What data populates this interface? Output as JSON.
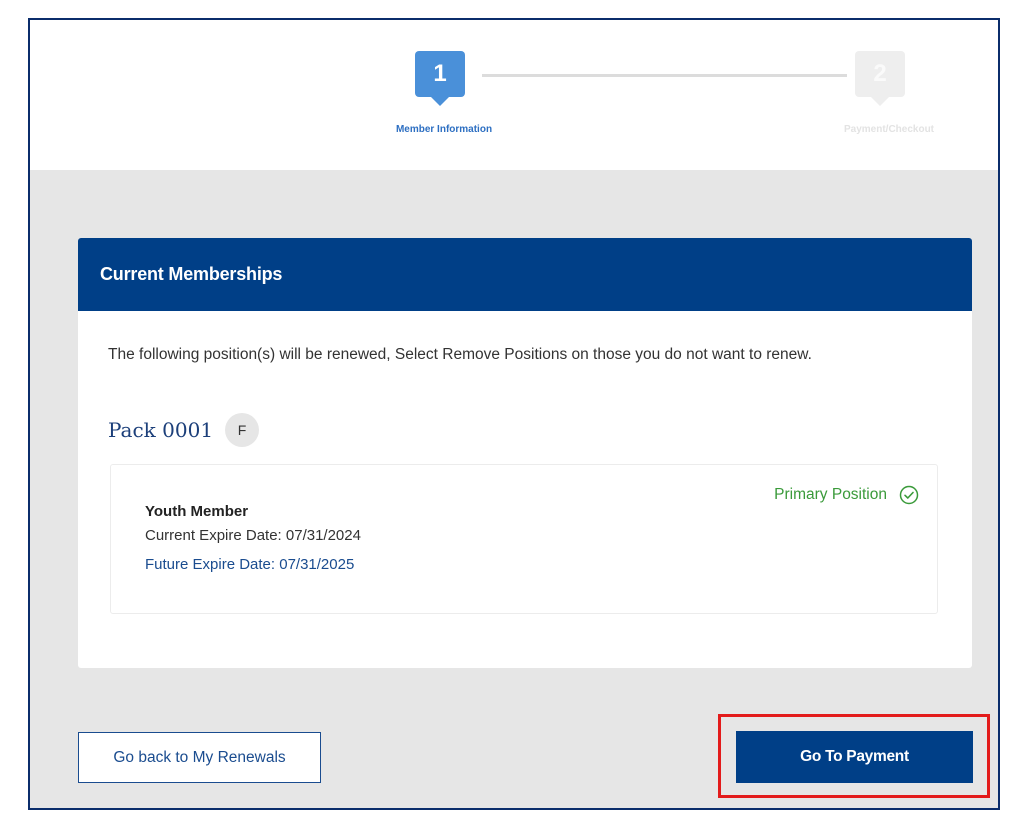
{
  "stepper": {
    "steps": [
      {
        "number": "1",
        "label": "Member Information",
        "state": "active"
      },
      {
        "number": "2",
        "label": "Payment/Checkout",
        "state": "inactive"
      }
    ]
  },
  "memberships": {
    "header": "Current Memberships",
    "intro": "The following position(s) will be renewed, Select Remove Positions on those you do not want to renew.",
    "unit_name": "Pack 0001",
    "unit_badge": "F",
    "position": {
      "title": "Youth Member",
      "current_expire": "Current Expire Date: 07/31/2024",
      "future_expire": "Future Expire Date: 07/31/2025",
      "primary_label": "Primary Position",
      "primary_icon": "check-circle-icon"
    }
  },
  "actions": {
    "back_label": "Go back to My Renewals",
    "payment_label": "Go To Payment"
  },
  "colors": {
    "primary": "#003f87",
    "step_active": "#4a90d9",
    "success": "#3a9a3a",
    "highlight": "#e31b1b"
  }
}
